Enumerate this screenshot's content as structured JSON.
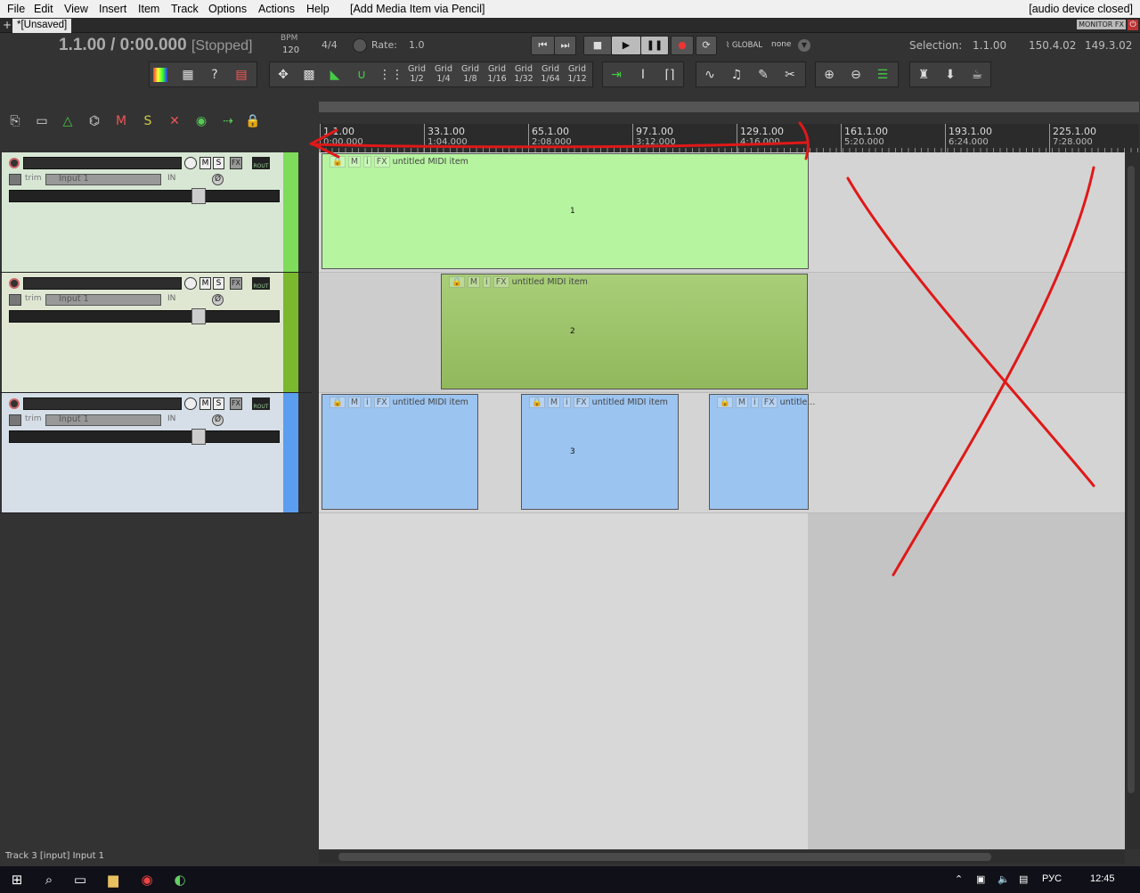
{
  "menu": {
    "items": [
      "File",
      "Edit",
      "View",
      "Insert",
      "Item",
      "Track",
      "Options",
      "Actions",
      "Help"
    ],
    "action_hint": "[Add Media Item via Pencil]",
    "device_status": "[audio device closed]"
  },
  "tabs": {
    "add": "+",
    "active": "*[Unsaved]",
    "monitor_fx": "MONITOR FX"
  },
  "transport": {
    "position": "1.1.00 / 0:00.000",
    "state": "[Stopped]",
    "bpm_label": "BPM",
    "bpm": "120",
    "time_sig": "4/4",
    "rate_label": "Rate:",
    "rate": "1.0",
    "global_label": "GLOBAL",
    "automation": "none",
    "selection_label": "Selection:",
    "selection_start": "1.1.00",
    "selection_end": "150.4.02",
    "selection_length": "149.3.02"
  },
  "toolbar": {
    "grid": [
      "Grid 1/2",
      "Grid 1/4",
      "Grid 1/8",
      "Grid 1/16",
      "Grid 1/32",
      "Grid 1/64",
      "Grid 1/12"
    ]
  },
  "ruler": {
    "marks": [
      {
        "bar": "1.1.00",
        "time": "0:00.000"
      },
      {
        "bar": "33.1.00",
        "time": "1:04.000"
      },
      {
        "bar": "65.1.00",
        "time": "2:08.000"
      },
      {
        "bar": "97.1.00",
        "time": "3:12.000"
      },
      {
        "bar": "129.1.00",
        "time": "4:16.000"
      },
      {
        "bar": "161.1.00",
        "time": "5:20.000"
      },
      {
        "bar": "193.1.00",
        "time": "6:24.000"
      },
      {
        "bar": "225.1.00",
        "time": "7:28.000"
      }
    ]
  },
  "tracks": [
    {
      "number": "1",
      "input": "Input 1",
      "trim": "trim",
      "in": "IN",
      "mute": "M",
      "solo": "S",
      "fx": "FX",
      "route": "ROUT",
      "color": "#7fdc5a"
    },
    {
      "number": "2",
      "input": "Input 1",
      "trim": "trim",
      "in": "IN",
      "mute": "M",
      "solo": "S",
      "fx": "FX",
      "route": "ROUT",
      "color": "#7ab82e"
    },
    {
      "number": "3",
      "input": "Input 1",
      "trim": "trim",
      "in": "IN",
      "mute": "M",
      "solo": "S",
      "fx": "FX",
      "route": "ROUT",
      "color": "#5b9ef0"
    }
  ],
  "items": [
    {
      "track": 1,
      "label": "untitled MIDI item",
      "color": "#b6f4a0"
    },
    {
      "track": 2,
      "label": "untitled MIDI item",
      "color": "#9cc46a"
    },
    {
      "track": 3,
      "label": "untitled MIDI item",
      "color": "#9cc4f0"
    },
    {
      "track": 3,
      "label": "untitled MIDI item",
      "color": "#9cc4f0"
    },
    {
      "track": 3,
      "label": "untitle...",
      "color": "#9cc4f0"
    }
  ],
  "item_buttons": {
    "mute": "M",
    "info": "i",
    "fx": "FX"
  },
  "status": "Track 3 [input] Input 1",
  "taskbar": {
    "lang": "РУС",
    "clock": "12:45"
  }
}
